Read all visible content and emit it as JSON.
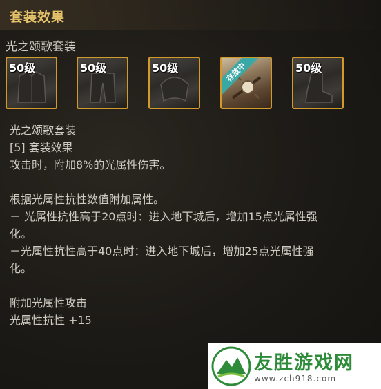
{
  "header": {
    "title": "套装效果"
  },
  "set": {
    "name": "光之颂歌套装"
  },
  "items": [
    {
      "level": "50级",
      "icon": "armor-shirt-icon"
    },
    {
      "level": "50级",
      "icon": "armor-pants-icon"
    },
    {
      "level": "50级",
      "icon": "armor-shoulder-icon"
    },
    {
      "ribbon": "存放中",
      "icon": "weapon-bow-icon"
    },
    {
      "level": "50级",
      "icon": "armor-boots-icon"
    }
  ],
  "description": {
    "set_title": "光之颂歌套装",
    "effect_header": "[5] 套装效果",
    "effect_line": "攻击时，附加8%的光属性伤害。",
    "resist_intro": "根据光属性抗性数值附加属性。",
    "tier1_a": "－ 光属性抗性高于20点时：进入地下城后，增加15点光属性强",
    "tier1_b": "化。",
    "tier2_a": "－光属性抗性高于40点时：进入地下城后，增加25点光属性强",
    "tier2_b": "化。",
    "bonus_attack": "附加光属性攻击",
    "bonus_resist": "光属性抗性 +15"
  },
  "watermark": {
    "name": "友胜游戏网",
    "url": "www.zch918.com"
  },
  "colors": {
    "title": "#e6c36b",
    "text": "#cfcbc2",
    "frame": "#d39a2a",
    "ribbon": "#3aa9a6",
    "watermark": "#2e8b3a"
  }
}
